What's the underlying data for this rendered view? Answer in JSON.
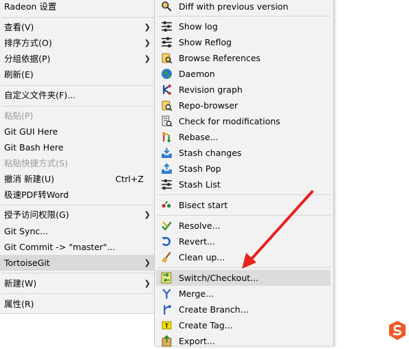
{
  "context_menu": {
    "items": [
      {
        "label": "Radeon 设置"
      },
      {
        "label": "查看(V)"
      },
      {
        "label": "排序方式(O)"
      },
      {
        "label": "分组依据(P)"
      },
      {
        "label": "刷新(E)"
      },
      {
        "label": "自定义文件夹(F)..."
      },
      {
        "label": "粘贴(P)"
      },
      {
        "label": "Git GUI Here"
      },
      {
        "label": "Git Bash Here"
      },
      {
        "label": "粘贴快捷方式(S)"
      },
      {
        "label": "撤消 新建(U)",
        "shortcut": "Ctrl+Z"
      },
      {
        "label": "极速PDF转Word"
      },
      {
        "label": "授予访问权限(G)"
      },
      {
        "label": "Git Sync..."
      },
      {
        "label": "Git Commit -> \"master\"..."
      },
      {
        "label": "TortoiseGit"
      },
      {
        "label": "新建(W)"
      },
      {
        "label": "属性(R)"
      }
    ]
  },
  "tortoisegit_submenu": {
    "items": [
      {
        "label": "Diff with previous version",
        "icon": "diff-icon"
      },
      {
        "label": "Show log",
        "icon": "log-icon"
      },
      {
        "label": "Show Reflog",
        "icon": "reflog-icon"
      },
      {
        "label": "Browse References",
        "icon": "references-icon"
      },
      {
        "label": "Daemon",
        "icon": "globe-icon"
      },
      {
        "label": "Revision graph",
        "icon": "revision-graph-icon"
      },
      {
        "label": "Repo-browser",
        "icon": "repo-browser-icon"
      },
      {
        "label": "Check for modifications",
        "icon": "check-modifications-icon"
      },
      {
        "label": "Rebase...",
        "icon": "rebase-icon"
      },
      {
        "label": "Stash changes",
        "icon": "stash-icon"
      },
      {
        "label": "Stash Pop",
        "icon": "stash-pop-icon"
      },
      {
        "label": "Stash List",
        "icon": "stash-list-icon"
      },
      {
        "label": "Bisect start",
        "icon": "bisect-icon"
      },
      {
        "label": "Resolve...",
        "icon": "resolve-icon"
      },
      {
        "label": "Revert...",
        "icon": "revert-icon"
      },
      {
        "label": "Clean up...",
        "icon": "cleanup-icon"
      },
      {
        "label": "Switch/Checkout...",
        "icon": "switch-checkout-icon"
      },
      {
        "label": "Merge...",
        "icon": "merge-icon"
      },
      {
        "label": "Create Branch...",
        "icon": "branch-icon"
      },
      {
        "label": "Create Tag...",
        "icon": "tag-icon"
      },
      {
        "label": "Export...",
        "icon": "export-icon"
      }
    ]
  },
  "colors": {
    "menu_bg": "#f2f2f2",
    "highlight": "#d9d9d9",
    "annotation_arrow": "#e8211d",
    "watermark": "#f05a28"
  }
}
